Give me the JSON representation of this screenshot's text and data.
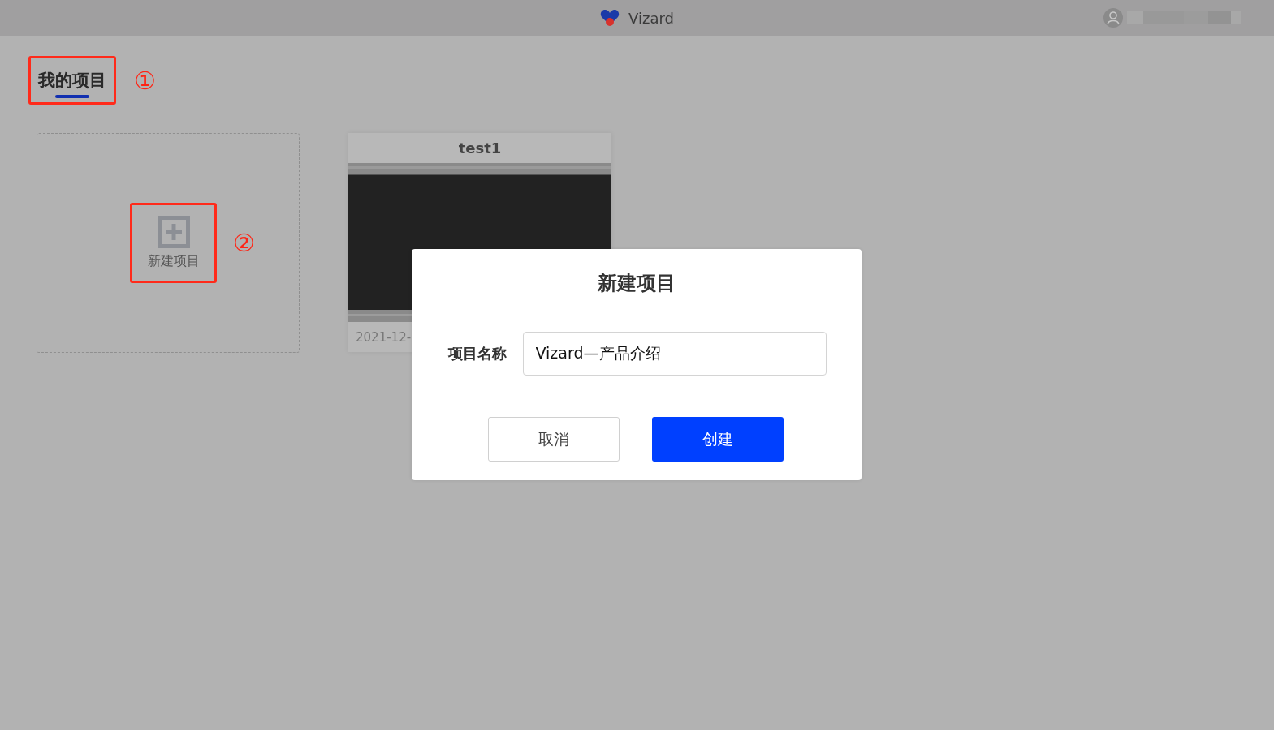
{
  "header": {
    "title": "Vizard"
  },
  "tabs": [
    {
      "label": "我的项目",
      "selected": true,
      "highlighted": true,
      "annotation": "①"
    }
  ],
  "new_project": {
    "label": "新建项目",
    "highlighted": true,
    "annotation": "②"
  },
  "projects": [
    {
      "title": "test1",
      "date": "2021-12-"
    }
  ],
  "dialog": {
    "title": "新建项目",
    "field_label": "项目名称",
    "field_value": "Vizard—产品介绍",
    "buttons": [
      {
        "label": "取消",
        "kind": "secondary"
      },
      {
        "label": "创建",
        "kind": "primary"
      }
    ]
  }
}
